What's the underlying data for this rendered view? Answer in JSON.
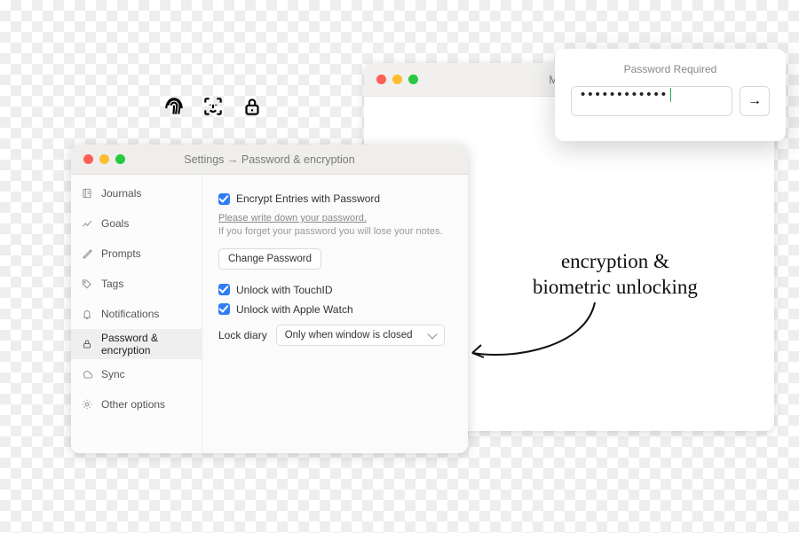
{
  "icons": [
    "fingerprint-icon",
    "faceid-icon",
    "lock-icon"
  ],
  "diary": {
    "date": "Mon, Jul",
    "annotation": "encryption &\nbiometric unlocking"
  },
  "password_popup": {
    "title": "Password Required",
    "value": "••••••••••••",
    "submit_glyph": "→"
  },
  "settings": {
    "title": "Settings → Password & encryption",
    "sidebar": [
      {
        "label": "Journals"
      },
      {
        "label": "Goals"
      },
      {
        "label": "Prompts"
      },
      {
        "label": "Tags"
      },
      {
        "label": "Notifications"
      },
      {
        "label": "Password & encryption"
      },
      {
        "label": "Sync"
      },
      {
        "label": "Other options"
      }
    ],
    "selected_index": 5,
    "pane": {
      "encrypt_label": "Encrypt Entries with Password",
      "hint_underlined": "Please write down your password.",
      "hint_rest": "If you forget your password you will lose your notes.",
      "change_password_btn": "Change Password",
      "touchid_label": "Unlock with TouchID",
      "watch_label": "Unlock with Apple Watch",
      "lock_label": "Lock diary",
      "lock_value": "Only when window is closed"
    }
  }
}
